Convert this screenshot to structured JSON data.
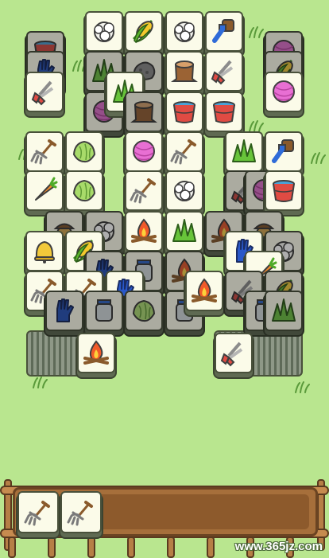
{
  "colors": {
    "background": "#b9e68f",
    "tile_face": "#fbfbe9",
    "tray_wood": "#a66f3b"
  },
  "board": {
    "tiles": [
      "cotton-icon",
      "corn-icon",
      "cotton-icon",
      "brush-icon",
      "bucket-icon",
      "glove-icon",
      "yarn-icon",
      "corn-icon",
      "pruner-icon",
      "grass-icon",
      "rock-icon",
      "stump-icon",
      "pruner-icon",
      "yarn-icon",
      "yarn-icon",
      "grass-icon",
      "stump-icon",
      "bucket-icon",
      "bucket-icon",
      "fork-icon",
      "lettuce-icon",
      "yarn-icon",
      "fork-icon",
      "grass-icon",
      "brush-icon",
      "carrot-icon",
      "lettuce-icon",
      "fork-icon",
      "cotton-icon",
      "pruner-icon",
      "yarn-icon",
      "bucket-icon",
      "acorn-icon",
      "cotton-icon",
      "campfire-icon",
      "grass-icon",
      "campfire-icon",
      "acorn-icon",
      "bell-icon",
      "corn-icon",
      "glove-icon",
      "jar-icon",
      "campfire-icon",
      "glove-icon",
      "cotton-icon",
      "carrot-icon",
      "fork-icon",
      "fork-icon",
      "glove-icon",
      "jar-icon",
      "campfire-icon",
      "pruner-icon",
      "corn-icon",
      "glove-icon",
      "jar-icon",
      "lettuce-icon",
      "jar-icon",
      "grass-icon",
      "campfire-icon",
      "pruner-icon"
    ],
    "stacks": [
      "left-stack",
      "right-stack"
    ]
  },
  "tray": {
    "slots": [
      "fork-icon",
      "fork-icon"
    ]
  },
  "watermark": "www.365jz.com"
}
